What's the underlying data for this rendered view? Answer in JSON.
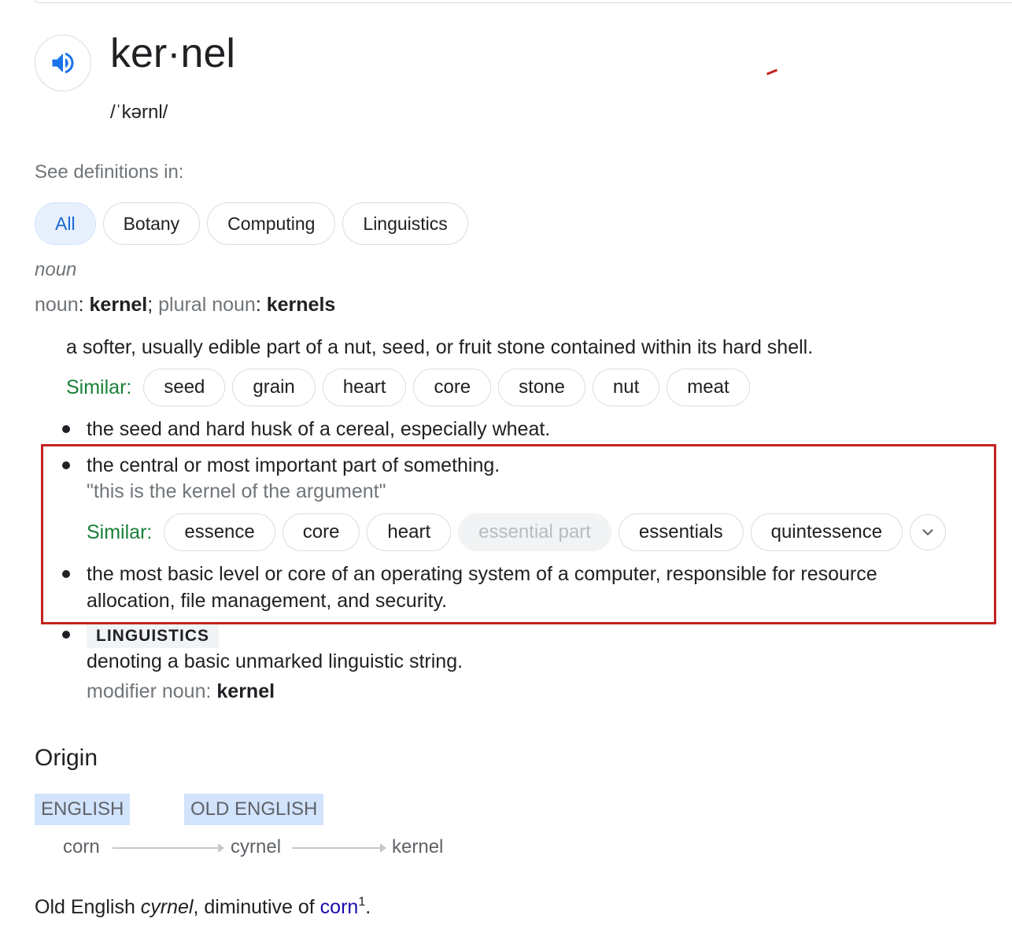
{
  "entry": {
    "word": "ker·nel",
    "phonetic": "/ˈkərnl/",
    "speaker_icon": "speaker-volume-icon"
  },
  "categories": {
    "label": "See definitions in:",
    "items": [
      "All",
      "Botany",
      "Computing",
      "Linguistics"
    ],
    "active": "All"
  },
  "noun_section": {
    "part_of_speech": "noun",
    "forms": {
      "singular_label": "noun",
      "singular": "kernel",
      "plural_label": "plural noun",
      "plural": "kernels",
      "colon": ":",
      "semicolon": ";"
    },
    "definition_1": "a softer, usually edible part of a nut, seed, or fruit stone contained within its hard shell.",
    "similar_label": "Similar:",
    "similar_1": [
      "seed",
      "grain",
      "heart",
      "core",
      "stone",
      "nut",
      "meat"
    ],
    "bullets": {
      "b1": "the seed and hard husk of a cereal, especially wheat.",
      "b2": "the central or most important part of something.",
      "b2_example": "\"this is the kernel of the argument\"",
      "similar_2": [
        "essence",
        "core",
        "heart",
        "essential part",
        "essentials",
        "quintessence"
      ],
      "similar_2_disabled": "essential part",
      "b3_line1": "the most basic level or core of an operating system of a computer, responsible for resource",
      "b3_line2": "allocation, file management, and security.",
      "b4_tag": "LINGUISTICS",
      "b4_def": "denoting a basic unmarked linguistic string.",
      "b4_modifier_label": "modifier noun",
      "b4_modifier_value": "kernel"
    }
  },
  "origin": {
    "title": "Origin",
    "languages": [
      "ENGLISH",
      "OLD ENGLISH"
    ],
    "chain": [
      "corn",
      "cyrnel",
      "kernel"
    ],
    "text_prefix": "Old English ",
    "text_italic": "cyrnel",
    "text_middle": ", diminutive of ",
    "text_link": "corn",
    "text_sup": "1",
    "text_end": "."
  },
  "colors": {
    "accent_blue": "#1967d2",
    "similar_green": "#188038",
    "highlight_red": "#c5221f",
    "link": "#1a0dab"
  }
}
